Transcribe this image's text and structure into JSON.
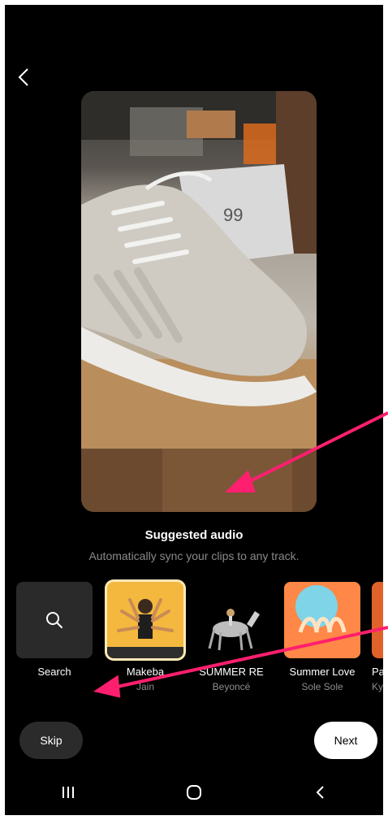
{
  "header": {
    "back_icon": "chevron-left-icon"
  },
  "preview": {
    "subject": "sneaker-video-preview",
    "price_tag": "99"
  },
  "suggested_audio": {
    "title": "Suggested audio",
    "subtitle": "Automatically sync your clips to any track."
  },
  "tracks": [
    {
      "name": "Search",
      "artist": "",
      "icon": "search-icon"
    },
    {
      "name": "Makeba",
      "artist": "Jain",
      "selected": true
    },
    {
      "name": "SUMMER RE",
      "artist": "Beyoncé"
    },
    {
      "name": "Summer Love",
      "artist": "Sole Sole"
    },
    {
      "name": "Pad",
      "artist": "Kyli"
    }
  ],
  "actions": {
    "skip_label": "Skip",
    "next_label": "Next"
  },
  "colors": {
    "annotation_arrow": "#ff1f6e",
    "selected_border": "#ffe9b8"
  },
  "navbar": {
    "icons": [
      "recent-apps-icon",
      "home-icon",
      "back-nav-icon"
    ]
  }
}
